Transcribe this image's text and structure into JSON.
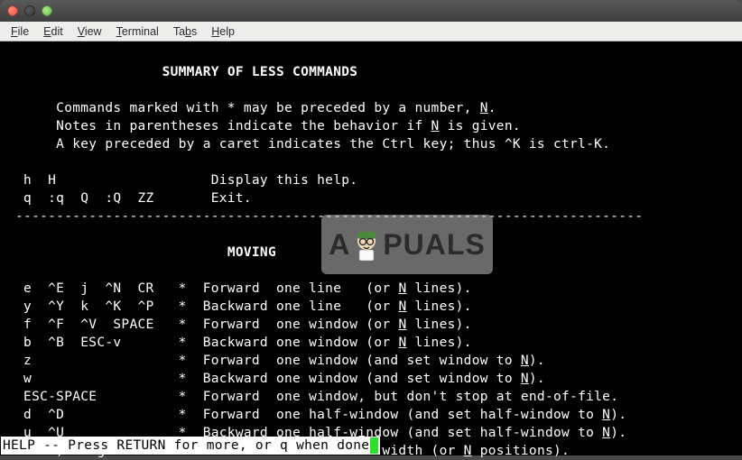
{
  "window": {
    "menus": [
      "File",
      "Edit",
      "View",
      "Terminal",
      "Tabs",
      "Help"
    ]
  },
  "content": {
    "title": "SUMMARY OF LESS COMMANDS",
    "intro": [
      {
        "pre": "      Commands marked with * may be preceded by a number, ",
        "u": "N",
        "post": "."
      },
      {
        "pre": "      Notes in parentheses indicate the behavior if ",
        "u": "N",
        "post": " is given."
      },
      {
        "pre": "      A key preceded by a caret indicates the Ctrl key; thus ^K is ctrl-K.",
        "u": "",
        "post": ""
      }
    ],
    "help": [
      {
        "keys": "  h  H",
        "desc": "Display this help."
      },
      {
        "keys": "  q  :q  Q  :Q  ZZ",
        "desc": "Exit."
      }
    ],
    "divider": " -----------------------------------------------------------------------------",
    "section2": "MOVING",
    "moving": [
      {
        "keys": "  e  ^E  j  ^N  CR",
        "star": "*",
        "d1": "Forward  one line   (or ",
        "u": "N",
        "d2": " lines)."
      },
      {
        "keys": "  y  ^Y  k  ^K  ^P",
        "star": "*",
        "d1": "Backward one line   (or ",
        "u": "N",
        "d2": " lines)."
      },
      {
        "keys": "  f  ^F  ^V  SPACE",
        "star": "*",
        "d1": "Forward  one window (or ",
        "u": "N",
        "d2": " lines)."
      },
      {
        "keys": "  b  ^B  ESC-v",
        "star": "*",
        "d1": "Backward one window (or ",
        "u": "N",
        "d2": " lines)."
      },
      {
        "keys": "  z",
        "star": "*",
        "d1": "Forward  one window (and set window to ",
        "u": "N",
        "d2": ")."
      },
      {
        "keys": "  w",
        "star": "*",
        "d1": "Backward one window (and set window to ",
        "u": "N",
        "d2": ")."
      },
      {
        "keys": "  ESC-SPACE",
        "star": "*",
        "d1": "Forward  one window, but don't stop at end-of-file.",
        "u": "",
        "d2": ""
      },
      {
        "keys": "  d  ^D",
        "star": "*",
        "d1": "Forward  one half-window (and set half-window to ",
        "u": "N",
        "d2": ")."
      },
      {
        "keys": "  u  ^U",
        "star": "*",
        "d1": "Backward one half-window (and set half-window to ",
        "u": "N",
        "d2": ")."
      },
      {
        "keys": "  ESC-)  RightArrow",
        "star": "*",
        "d1": "Left  one half screen width (or ",
        "u": "N",
        "d2": " positions)."
      }
    ],
    "status": "HELP -- Press RETURN for more, or q when done"
  },
  "watermark": {
    "left": "A",
    "right": "PUALS"
  }
}
